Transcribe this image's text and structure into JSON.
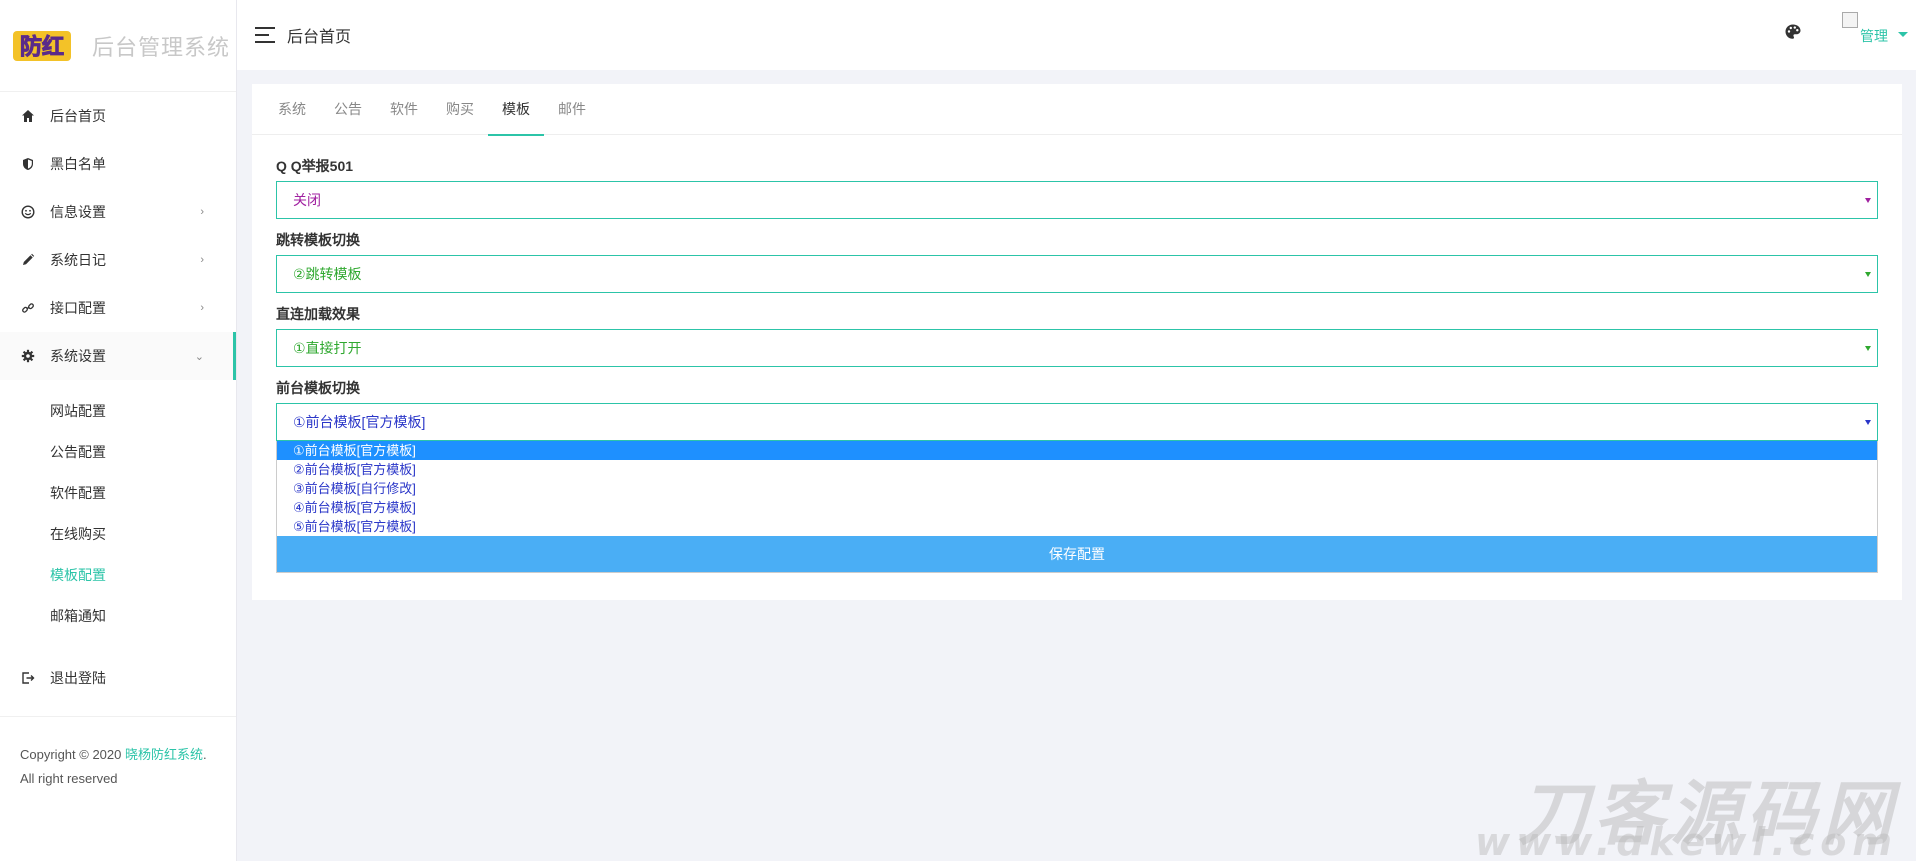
{
  "brand": {
    "logo_text": "防红",
    "title": "后台管理系统"
  },
  "sidebar": {
    "items": [
      {
        "label": "后台首页"
      },
      {
        "label": "黑白名单"
      },
      {
        "label": "信息设置"
      },
      {
        "label": "系统日记"
      },
      {
        "label": "接口配置"
      },
      {
        "label": "系统设置"
      }
    ],
    "sub_items": [
      {
        "label": "网站配置"
      },
      {
        "label": "公告配置"
      },
      {
        "label": "软件配置"
      },
      {
        "label": "在线购买"
      },
      {
        "label": "模板配置"
      },
      {
        "label": "邮箱通知"
      }
    ],
    "logout": "退出登陆",
    "copyright_prefix": "Copyright © 2020 ",
    "copyright_link": "晓杨防红系统",
    "copyright_suffix": ". All right reserved"
  },
  "topbar": {
    "title": "后台首页",
    "user": "管理"
  },
  "tabs": [
    "系统",
    "公告",
    "软件",
    "购买",
    "模板",
    "邮件"
  ],
  "form": {
    "fields": [
      {
        "label": "Q Q举报501",
        "value": "关闭"
      },
      {
        "label": "跳转模板切换",
        "value": "②跳转模板"
      },
      {
        "label": "直连加载效果",
        "value": "①直接打开"
      },
      {
        "label": "前台模板切换",
        "value": "①前台模板[官方模板]"
      }
    ],
    "dropdown_options": [
      "①前台模板[官方模板]",
      "②前台模板[官方模板]",
      "③前台模板[自行修改]",
      "④前台模板[官方模板]",
      "⑤前台模板[官方模板]"
    ],
    "save_label": "保存配置"
  },
  "watermark": {
    "line1": "刀客源码网",
    "line2": "www.dkewl.com"
  },
  "colors": {
    "accent": "#2cc4a8",
    "button": "#4aaef5",
    "highlight": "#1e90ff"
  }
}
